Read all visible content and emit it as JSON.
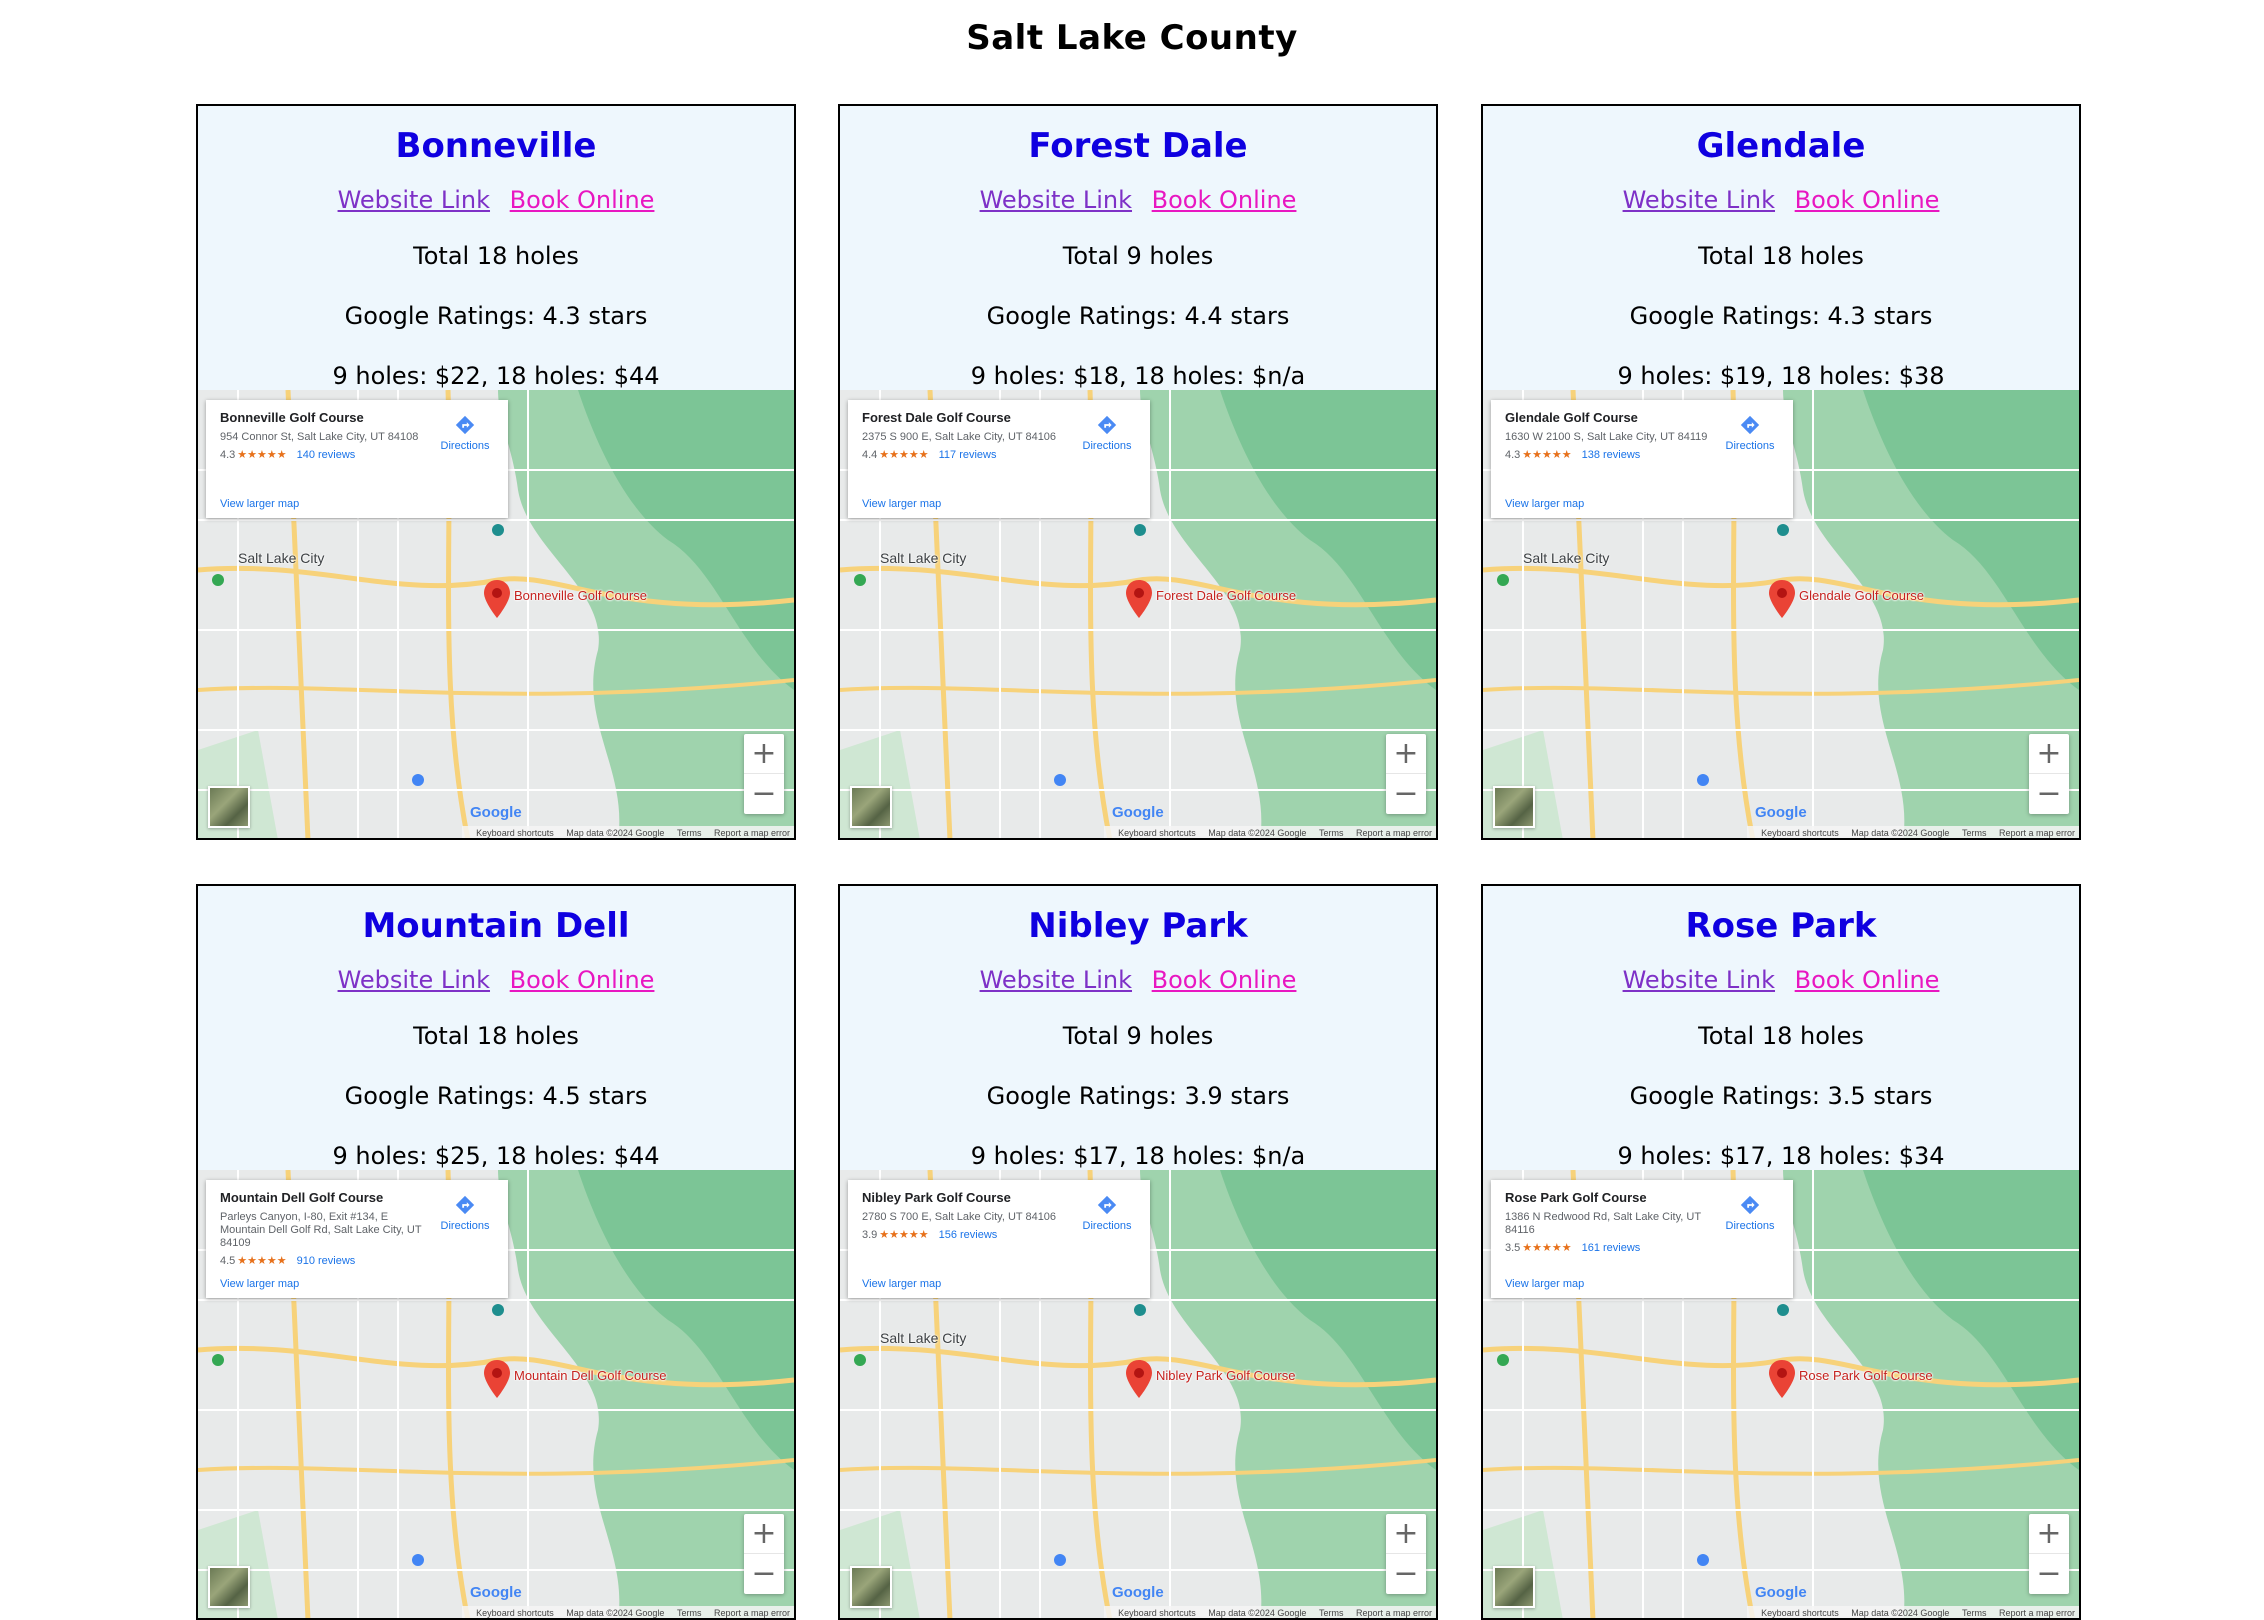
{
  "page": {
    "title": "Salt Lake County"
  },
  "common": {
    "website_link": "Website Link",
    "book_online": "Book Online",
    "directions": "Directions",
    "view_larger_map": "View larger map",
    "map_footer": {
      "keyboard": "Keyboard shortcuts",
      "data": "Map data ©2024 Google",
      "terms": "Terms",
      "report": "Report a map error"
    },
    "google": "Google",
    "zoom_in": "+",
    "zoom_out": "−"
  },
  "courses": [
    {
      "name": "Bonneville",
      "holes": "Total 18 holes",
      "rating": "Google Ratings: 4.3 stars",
      "price": "9 holes: $22,  18 holes: $44",
      "map": {
        "place": "Bonneville Golf Course",
        "address": "954 Connor St, Salt Lake City, UT 84108",
        "stars_value": "4.3",
        "stars": "★★★★★",
        "reviews": "140 reviews",
        "city": "Salt Lake City"
      }
    },
    {
      "name": "Forest Dale",
      "holes": "Total 9 holes",
      "rating": "Google Ratings: 4.4 stars",
      "price": "9 holes: $18,  18 holes: $n/a",
      "map": {
        "place": "Forest Dale Golf Course",
        "address": "2375 S 900 E, Salt Lake City, UT 84106",
        "stars_value": "4.4",
        "stars": "★★★★★",
        "reviews": "117 reviews",
        "city": "Salt Lake City"
      }
    },
    {
      "name": "Glendale",
      "holes": "Total 18 holes",
      "rating": "Google Ratings: 4.3 stars",
      "price": "9 holes: $19,  18 holes: $38",
      "map": {
        "place": "Glendale Golf Course",
        "address": "1630 W 2100 S, Salt Lake City, UT 84119",
        "stars_value": "4.3",
        "stars": "★★★★★",
        "reviews": "138 reviews",
        "city": "Salt Lake City"
      }
    },
    {
      "name": "Mountain Dell",
      "holes": "Total 18 holes",
      "rating": "Google Ratings: 4.5 stars",
      "price": "9 holes: $25,  18 holes: $44",
      "map": {
        "place": "Mountain Dell Golf Course",
        "address": "Parleys Canyon, I-80, Exit #134, E Mountain Dell Golf Rd, Salt Lake City, UT 84109",
        "stars_value": "4.5",
        "stars": "★★★★★",
        "reviews": "910 reviews",
        "city": ""
      }
    },
    {
      "name": "Nibley Park",
      "holes": "Total 9 holes",
      "rating": "Google Ratings: 3.9 stars",
      "price": "9 holes: $17,  18 holes: $n/a",
      "map": {
        "place": "Nibley Park Golf Course",
        "address": "2780 S 700 E, Salt Lake City, UT 84106",
        "stars_value": "3.9",
        "stars": "★★★★★",
        "reviews": "156 reviews",
        "city": "Salt Lake City"
      }
    },
    {
      "name": "Rose Park",
      "holes": "Total 18 holes",
      "rating": "Google Ratings: 3.5 stars",
      "price": "9 holes: $17,  18 holes: $34",
      "map": {
        "place": "Rose Park Golf Course",
        "address": "1386 N Redwood Rd, Salt Lake City, UT 84116",
        "stars_value": "3.5",
        "stars": "★★★★★",
        "reviews": "161 reviews",
        "city": ""
      }
    }
  ]
}
